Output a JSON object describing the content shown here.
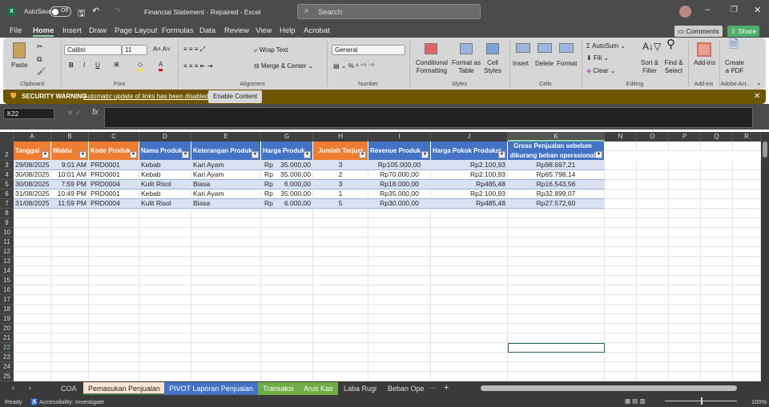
{
  "title": {
    "autosave": "AutoSave",
    "autosave_state": "Off",
    "doc": "Financial Statement  -  Repaired  -  Excel",
    "search": "Search"
  },
  "menu": [
    "File",
    "Home",
    "Insert",
    "Draw",
    "Page Layout",
    "Formulas",
    "Data",
    "Review",
    "View",
    "Help",
    "Acrobat"
  ],
  "actions": {
    "comments": "Comments",
    "share": "Share"
  },
  "ribbon": {
    "paste": "Paste",
    "font": "Calibri",
    "size": "11",
    "wrap": "Wrap Text",
    "merge": "Merge & Center",
    "numfmt": "General",
    "cond": "Conditional Formatting",
    "fmt_table": "Format as Table",
    "cell_styles": "Cell Styles",
    "insert": "Insert",
    "delete": "Delete",
    "format": "Format",
    "autosum": "AutoSum",
    "fill": "Fill",
    "clear": "Clear",
    "sort": "Sort & Filter",
    "find": "Find & Select",
    "addins": "Add-ins",
    "pdf": "Create a PDF",
    "groups": [
      "Clipboard",
      "Font",
      "Alignment",
      "Number",
      "Styles",
      "Cells",
      "Editing",
      "Add-ins",
      "Adobe Acr..."
    ]
  },
  "security": {
    "label": "SECURITY WARNING",
    "msg": "Automatic update of links has been disabled",
    "button": "Enable Content"
  },
  "formula": {
    "namebox": "K22",
    "fx": "fx",
    "value": ""
  },
  "colors": {
    "orange": "#ED7D31",
    "blue": "#4472C4",
    "band": "#D9E1F2"
  },
  "columns": [
    "A",
    "B",
    "C",
    "D",
    "E",
    "G",
    "H",
    "I",
    "J",
    "K",
    "N",
    "O",
    "P",
    "Q",
    "R"
  ],
  "table": {
    "headers": [
      "Tanggal",
      "Waktu",
      "Kode Produk",
      "Nama Produk",
      "Keterangan Produk",
      "Harga Produk",
      "Jumlah Terjual",
      "Revenue Produk",
      "Harga Pokok Produksi",
      "Gross Penjualan sebelum dikurang beban operasional"
    ],
    "header_colors": [
      "orange",
      "orange",
      "orange",
      "blue",
      "blue",
      "blue",
      "orange",
      "blue",
      "blue",
      "blue"
    ],
    "rows": [
      [
        "29/08/2025",
        "9:01 AM",
        "PRD0001",
        "Kebab",
        "Kari Ayam",
        "35.000,00",
        "3",
        "Rp105.000,00",
        "Rp2.100,93",
        "Rp98.697,21"
      ],
      [
        "30/08/2025",
        "10:01 AM",
        "PRD0001",
        "Kebab",
        "Kari Ayam",
        "35.000,00",
        "2",
        "Rp70.000,00",
        "Rp2.100,93",
        "Rp65.798,14"
      ],
      [
        "30/08/2025",
        "7:59 PM",
        "PRD0004",
        "Kulit Risol",
        "Biasa",
        "6.000,00",
        "3",
        "Rp18.000,00",
        "Rp485,48",
        "Rp16.543,56"
      ],
      [
        "31/08/2025",
        "10:49 PM",
        "PRD0001",
        "Kebab",
        "Kari Ayam",
        "35.000,00",
        "1",
        "Rp35.000,00",
        "Rp2.100,93",
        "Rp32.899,07"
      ],
      [
        "31/08/2025",
        "11:59 PM",
        "PRD0004",
        "Kulit Risol",
        "Biasa",
        "6.000,00",
        "5",
        "Rp30.000,00",
        "Rp485,48",
        "Rp27.572,60"
      ]
    ],
    "currency": "Rp"
  },
  "sheets": [
    {
      "name": "COA"
    },
    {
      "name": "Pemasukan Penjualan",
      "active": true
    },
    {
      "name": "PIVOT Laporan Penjualan",
      "color": "#4472C4"
    },
    {
      "name": "Transaksi",
      "color": "#70AD47"
    },
    {
      "name": "Arus Kas",
      "color": "#70AD47"
    },
    {
      "name": "Laba Rugi"
    },
    {
      "name": "Beban Ope"
    }
  ],
  "status": {
    "ready": "Ready",
    "accessibility": "Accessibility: Investigate",
    "zoom": "100%"
  }
}
